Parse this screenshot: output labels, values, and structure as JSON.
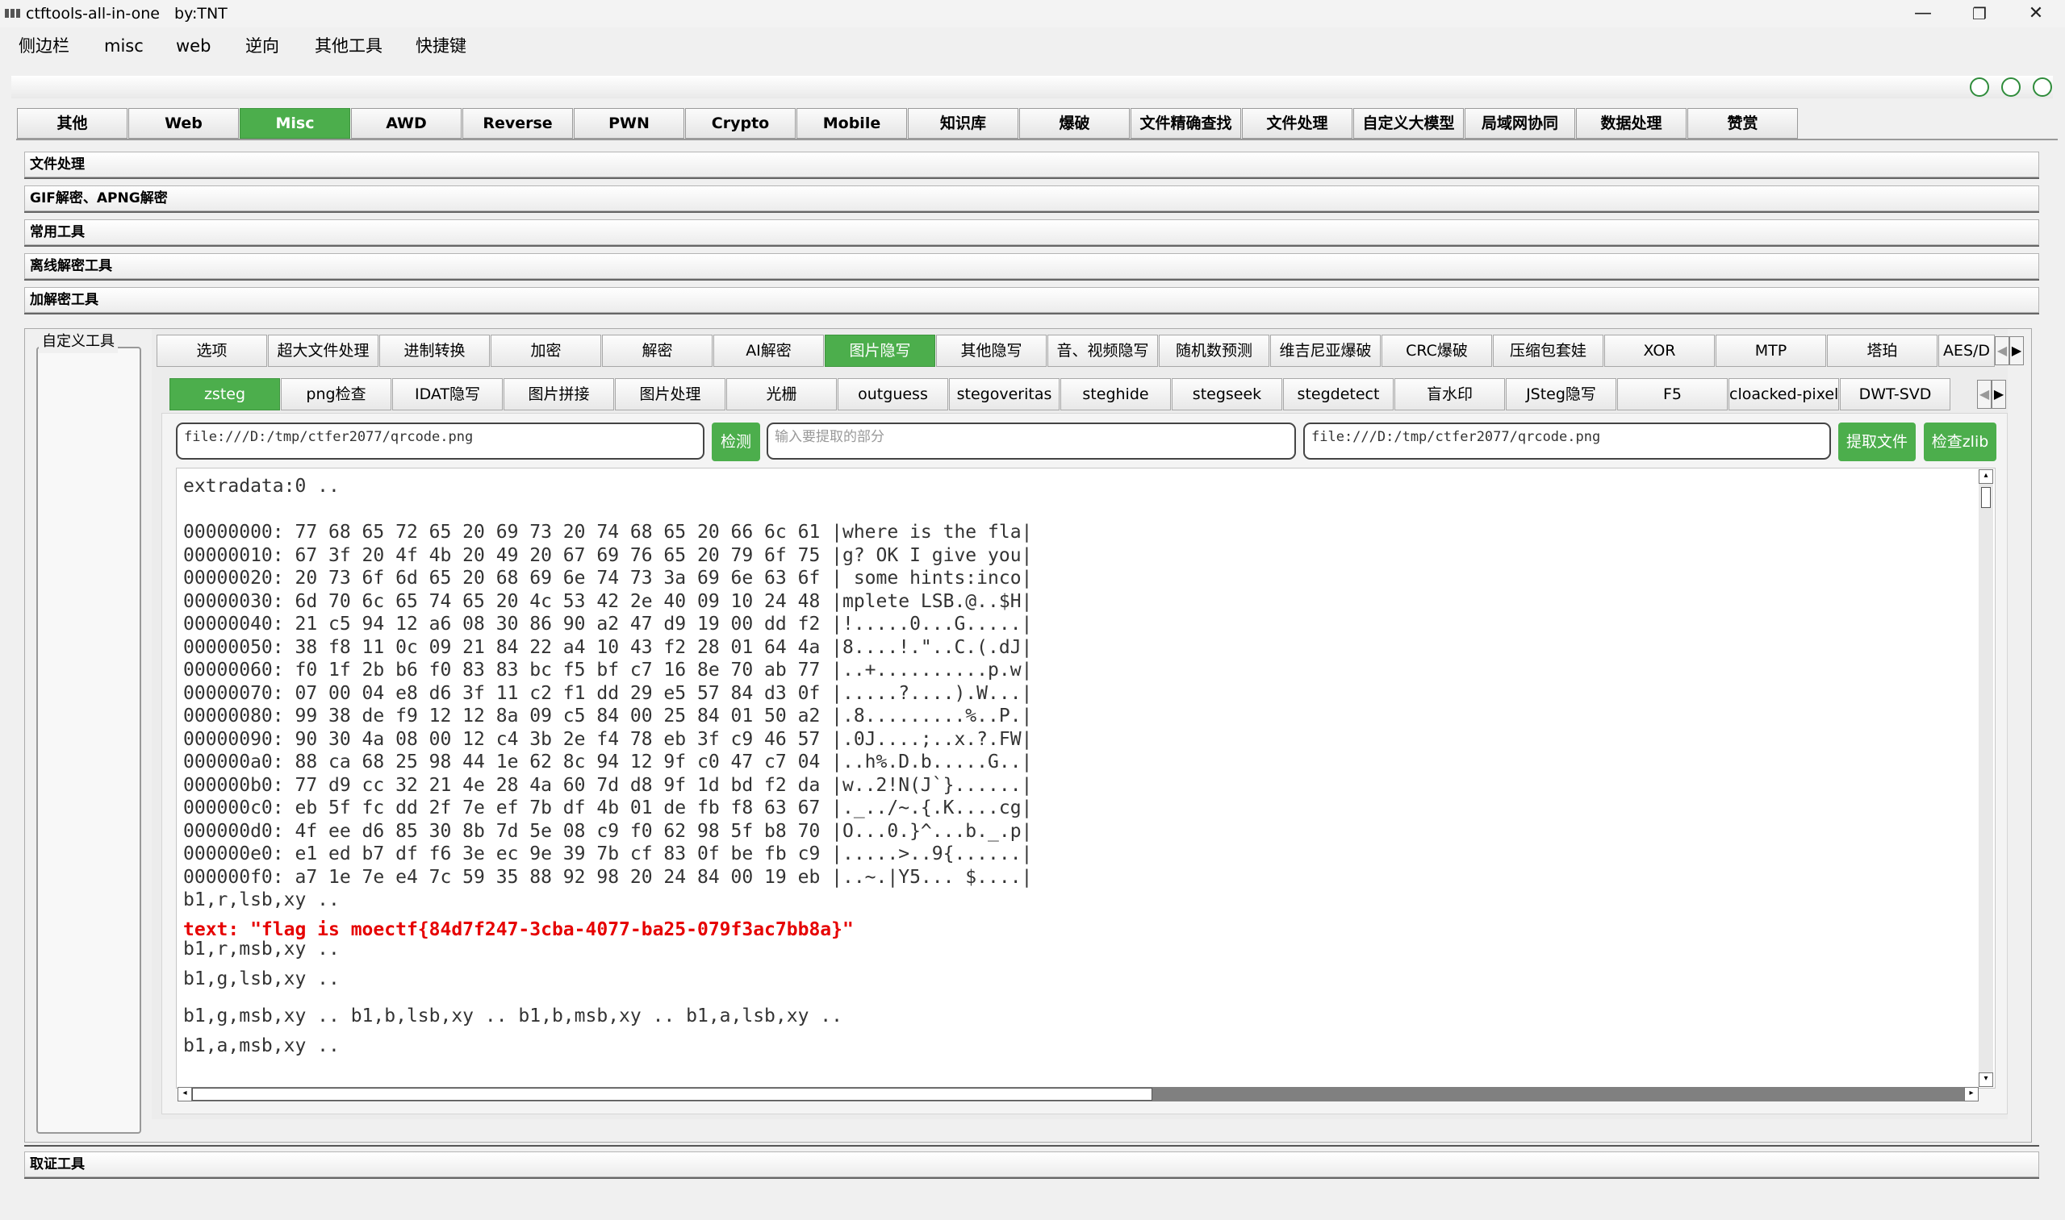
{
  "window": {
    "title": "ctftools-all-in-one   by:TNT",
    "minimize": "—",
    "maximize": "❐",
    "close": "✕"
  },
  "menu": [
    "侧边栏",
    "misc",
    "web",
    "逆向",
    "其他工具",
    "快捷键"
  ],
  "main_tabs": [
    "其他",
    "Web",
    "Misc",
    "AWD",
    "Reverse",
    "PWN",
    "Crypto",
    "Mobile",
    "知识库",
    "爆破",
    "文件精确查找",
    "文件处理",
    "自定义大模型",
    "局域网协同",
    "数据处理",
    "赞赏"
  ],
  "sections": [
    "文件处理",
    "GIF解密、APNG解密",
    "常用工具",
    "离线解密工具",
    "加解密工具"
  ],
  "custom_tools_label": "自定义工具",
  "forensics_section": "取证工具",
  "sub_tabs": [
    "选项",
    "超大文件处理",
    "进制转换",
    "加密",
    "解密",
    "AI解密",
    "图片隐写",
    "其他隐写",
    "音、视频隐写",
    "随机数预测",
    "维吉尼亚爆破",
    "CRC爆破",
    "压缩包套娃",
    "XOR",
    "MTP",
    "塔珀",
    "AES/D"
  ],
  "stego_tabs": [
    "zsteg",
    "png检查",
    "IDAT隐写",
    "图片拼接",
    "图片处理",
    "光栅",
    "outguess",
    "stegoveritas",
    "steghide",
    "stegseek",
    "stegdetect",
    "盲水印",
    "JSteg隐写",
    "F5",
    "cloacked-pixel",
    "DWT-SVD"
  ],
  "inputs": {
    "file_path": "file:///D:/tmp/ctfer2077/qrcode.png",
    "detect_button": "检测",
    "extract_placeholder": "输入要提取的部分",
    "file_path2": "file:///D:/tmp/ctfer2077/qrcode.png",
    "extract_button": "提取文件",
    "zlib_button": "检查zlib"
  },
  "output": {
    "header": "extradata:0 ..",
    "hex_lines": [
      "00000000: 77 68 65 72 65 20 69 73 20 74 68 65 20 66 6c 61 |where is the fla|",
      "00000010: 67 3f 20 4f 4b 20 49 20 67 69 76 65 20 79 6f 75 |g? OK I give you|",
      "00000020: 20 73 6f 6d 65 20 68 69 6e 74 73 3a 69 6e 63 6f | some hints:inco|",
      "00000030: 6d 70 6c 65 74 65 20 4c 53 42 2e 40 09 10 24 48 |mplete LSB.@..$H|",
      "00000040: 21 c5 94 12 a6 08 30 86 90 a2 47 d9 19 00 dd f2 |!.....0...G.....|",
      "00000050: 38 f8 11 0c 09 21 84 22 a4 10 43 f2 28 01 64 4a |8....!.\"..C.(.dJ|",
      "00000060: f0 1f 2b b6 f0 83 83 bc f5 bf c7 16 8e 70 ab 77 |..+..........p.w|",
      "00000070: 07 00 04 e8 d6 3f 11 c2 f1 dd 29 e5 57 84 d3 0f |.....?....).W...|",
      "00000080: 99 38 de f9 12 12 8a 09 c5 84 00 25 84 01 50 a2 |.8.........%..P.|",
      "00000090: 90 30 4a 08 00 12 c4 3b 2e f4 78 eb 3f c9 46 57 |.0J....;..x.?.FW|",
      "000000a0: 88 ca 68 25 98 44 1e 62 8c 94 12 9f c0 47 c7 04 |..h%.D.b.....G..|",
      "000000b0: 77 d9 cc 32 21 4e 28 4a 60 7d d8 9f 1d bd f2 da |w..2!N(J`}......|",
      "000000c0: eb 5f fc dd 2f 7e ef 7b df 4b 01 de fb f8 63 67 |._../~.{.K....cg|",
      "000000d0: 4f ee d6 85 30 8b 7d 5e 08 c9 f0 62 98 5f b8 70 |O...0.}^...b._.p|",
      "000000e0: e1 ed b7 df f6 3e ec 9e 39 7b cf 83 0f be fb c9 |.....>..9{......|",
      "000000f0: a7 1e 7e e4 7c 59 35 88 92 98 20 24 84 00 19 eb |..~.|Y5... $....|"
    ],
    "line1": "b1,r,lsb,xy ..",
    "flag": "text: \"flag is moectf{84d7f247-3cba-4077-ba25-079f3ac7bb8a}\"",
    "line2": "b1,r,msb,xy ..",
    "line3": "b1,g,lsb,xy ..",
    "line4": "b1,g,msb,xy .. b1,b,lsb,xy .. b1,b,msb,xy .. b1,a,lsb,xy ..",
    "line5": "b1,a,msb,xy .."
  },
  "colors": {
    "accent": "#4cae4c",
    "flag": "#e60000"
  }
}
